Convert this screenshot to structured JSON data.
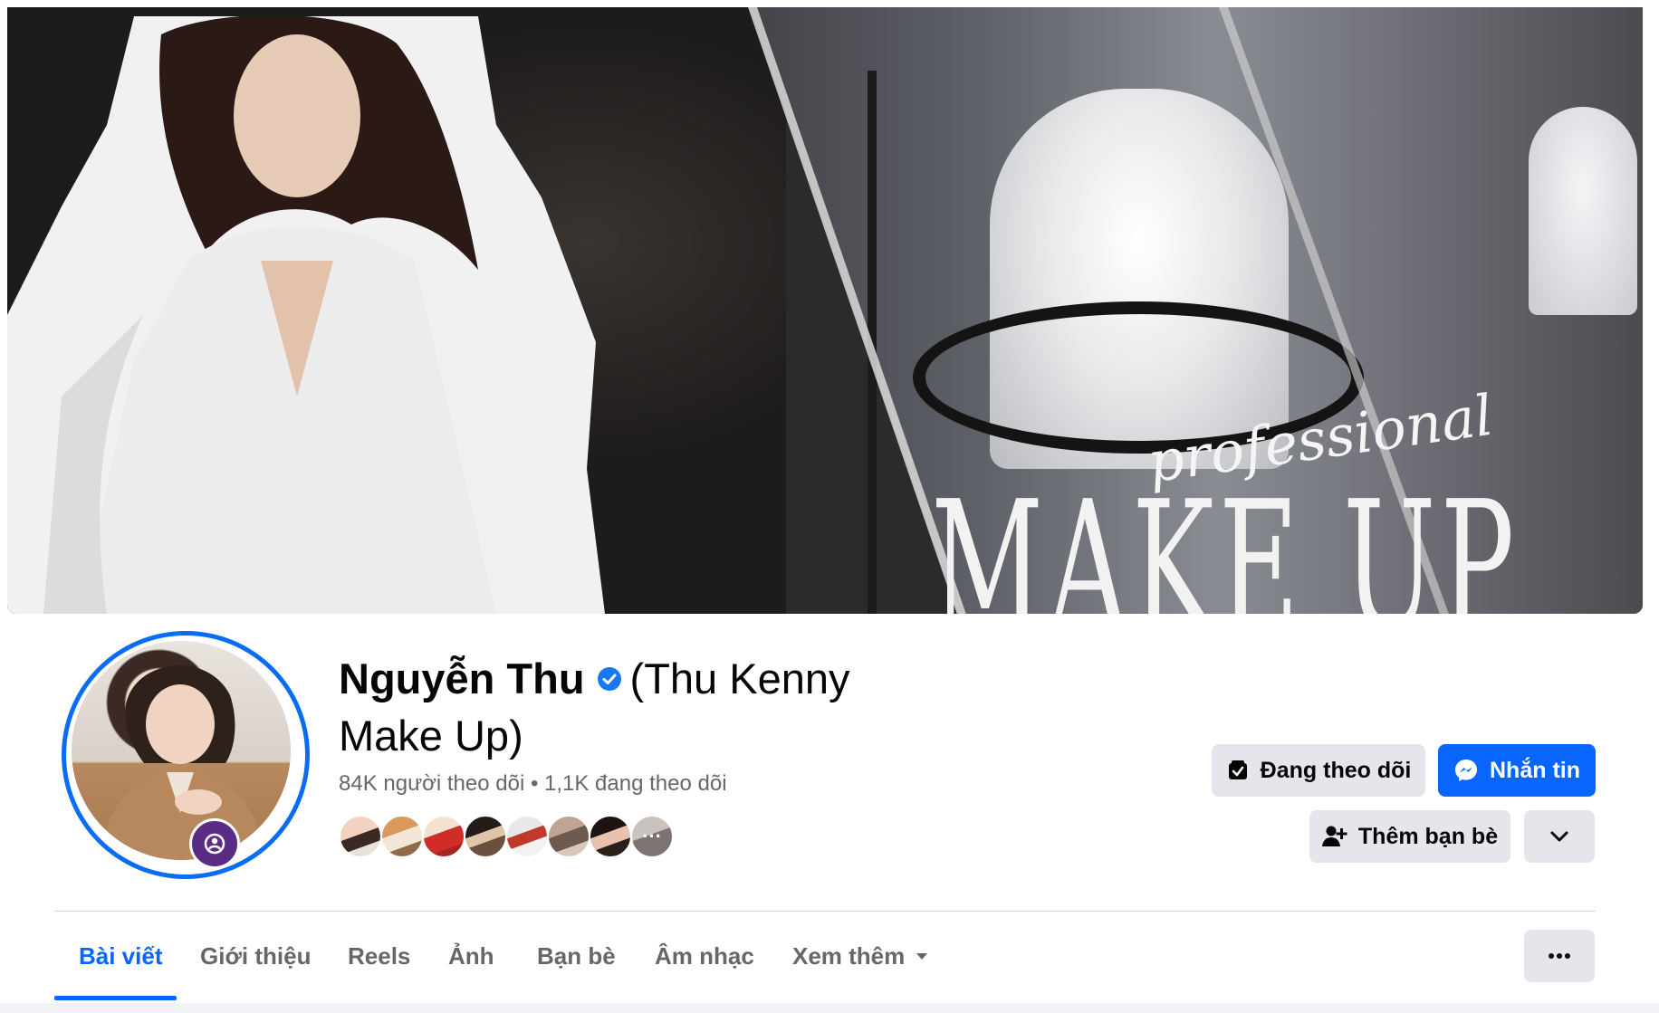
{
  "cover": {
    "script_text": "professional",
    "headline_text": "MAKE UP"
  },
  "profile": {
    "name_bold": "Nguyễn Thu",
    "name_rest_line1": "(Thu Kenny",
    "name_rest_line2": "Make Up)",
    "stats": "84K người theo dõi • 1,1K đang theo dõi",
    "verified_icon": "verified-badge-icon",
    "friend_avatar_count": 8
  },
  "actions": {
    "following_label": "Đang theo dõi",
    "message_label": "Nhắn tin",
    "add_friend_label": "Thêm bạn bè"
  },
  "tabs": [
    {
      "label": "Bài viết",
      "active": true
    },
    {
      "label": "Giới thiệu",
      "active": false
    },
    {
      "label": "Reels",
      "active": false
    },
    {
      "label": "Ảnh",
      "active": false
    },
    {
      "label": "Bạn bè",
      "active": false
    },
    {
      "label": "Âm nhạc",
      "active": false
    },
    {
      "label": "Xem thêm",
      "active": false
    }
  ],
  "colors": {
    "accent": "#0866ff",
    "button_gray": "#e4e6eb",
    "avatar_ring": "#0a6cf2",
    "secondary_text": "#65676b"
  }
}
